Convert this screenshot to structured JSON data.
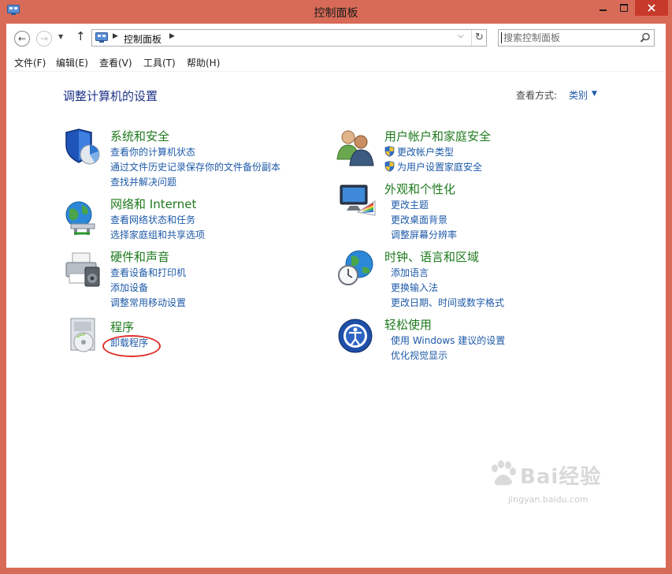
{
  "window": {
    "title": "控制面板",
    "colors": {
      "frame": "#d86b57",
      "close_button": "#c7392b",
      "link": "#1e5aa8",
      "category_title": "#1e7a1e",
      "page_title": "#1e3287"
    }
  },
  "navbar": {
    "back_icon": "back-arrow-icon",
    "forward_icon": "forward-arrow-icon",
    "up_icon": "up-arrow-icon",
    "address_location": "控制面板",
    "search_placeholder": "搜索控制面板"
  },
  "menu": [
    {
      "label": "文件(F)"
    },
    {
      "label": "编辑(E)"
    },
    {
      "label": "查看(V)"
    },
    {
      "label": "工具(T)"
    },
    {
      "label": "帮助(H)"
    }
  ],
  "main": {
    "heading": "调整计算机的设置",
    "view_by_label": "查看方式:",
    "view_by_value": "类别"
  },
  "categories": [
    {
      "title": "系统和安全",
      "icon": "shield-security-icon",
      "links": [
        "查看你的计算机状态",
        "通过文件历史记录保存你的文件备份副本",
        "查找并解决问题"
      ]
    },
    {
      "title": "网络和 Internet",
      "icon": "network-globe-icon",
      "links": [
        "查看网络状态和任务",
        "选择家庭组和共享选项"
      ]
    },
    {
      "title": "硬件和声音",
      "icon": "printer-hardware-icon",
      "links": [
        "查看设备和打印机",
        "添加设备",
        "调整常用移动设置"
      ]
    },
    {
      "title": "程序",
      "icon": "programs-disc-icon",
      "links": [
        "卸载程序"
      ]
    },
    {
      "title": "用户帐户和家庭安全",
      "icon": "users-icon",
      "links": [
        "更改帐户类型",
        "为用户设置家庭安全"
      ]
    },
    {
      "title": "外观和个性化",
      "icon": "monitor-palette-icon",
      "links": [
        "更改主题",
        "更改桌面背景",
        "调整屏幕分辨率"
      ]
    },
    {
      "title": "时钟、语言和区域",
      "icon": "clock-globe-icon",
      "links": [
        "添加语言",
        "更换输入法",
        "更改日期、时间或数字格式"
      ]
    },
    {
      "title": "轻松使用",
      "icon": "ease-of-access-icon",
      "links": [
        "使用 Windows 建议的设置",
        "优化视觉显示"
      ]
    }
  ],
  "watermark": {
    "brand": "Bai经验",
    "url": "jingyan.baidu.com"
  }
}
